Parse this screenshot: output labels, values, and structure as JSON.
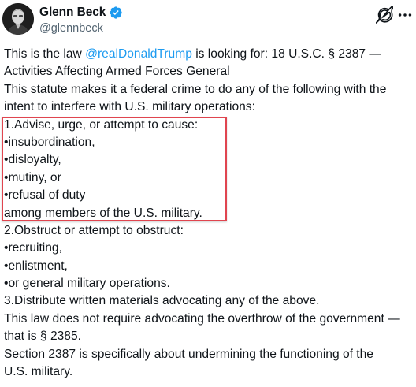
{
  "author": {
    "display_name": "Glenn Beck",
    "handle": "@glennbeck",
    "verified": true,
    "avatar_icon": "avatar-photo",
    "verified_color": "#1d9bf0"
  },
  "actions": {
    "grok_icon": "grok-icon",
    "more_icon": "more-icon"
  },
  "tweet": {
    "line1_prefix": "This is the law ",
    "line1_mention": "@realDonaldTrump",
    "line1_suffix": " is looking for:  18 U.S.C. § 2387 —",
    "lines": [
      "Activities Affecting Armed Forces General",
      "This statute makes it a federal crime to do any of the following with the",
      "intent to interfere with U.S. military operations:",
      "1.Advise, urge, or attempt to cause:",
      "•insubordination,",
      "•disloyalty,",
      "•mutiny, or",
      "•refusal of duty",
      "among members of the U.S. military.",
      "2.Obstruct or attempt to obstruct:",
      "•recruiting,",
      "•enlistment,",
      "•or general military operations.",
      "3.Distribute written materials advocating any of the above.",
      "This law does not require advocating the overthrow of the government —",
      "that is § 2385.",
      "Section 2387 is specifically about undermining the functioning of the",
      "U.S. military."
    ]
  },
  "colors": {
    "mention": "#1d9bf0",
    "highlight_border": "#e0454f",
    "text": "#0f1419",
    "secondary": "#536471"
  }
}
